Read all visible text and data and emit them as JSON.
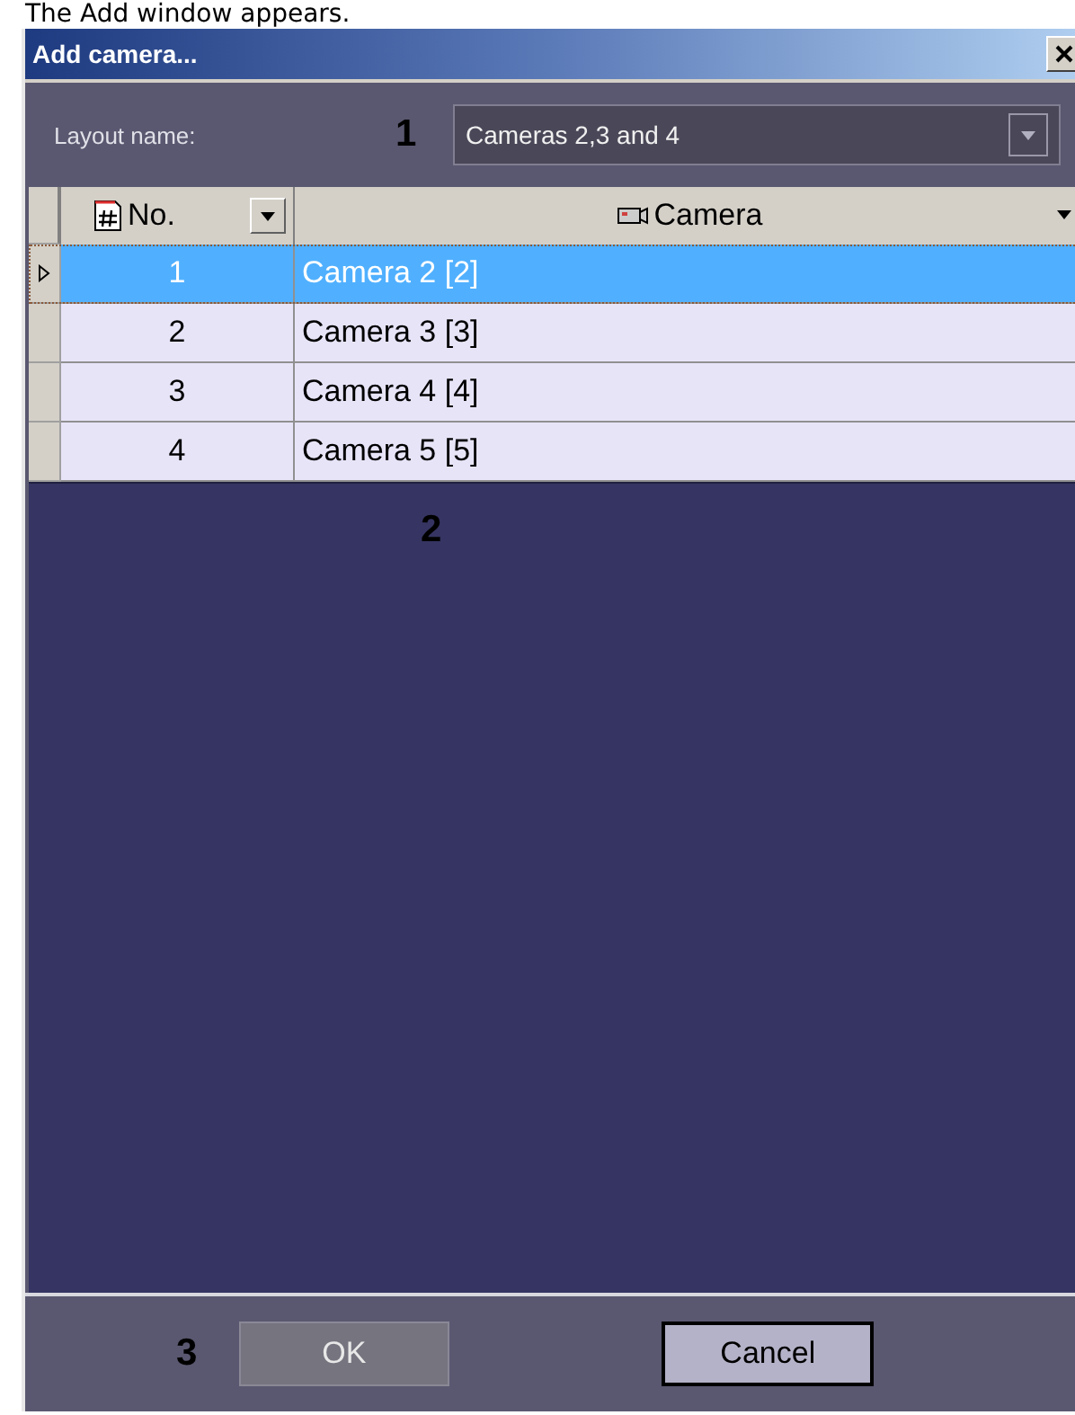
{
  "caption": "The Add window appears.",
  "window": {
    "title": "Add camera..."
  },
  "layout": {
    "label": "Layout name:",
    "callout": "1",
    "value": "Cameras 2,3 and 4"
  },
  "table": {
    "columns": [
      {
        "label": "No.",
        "kind": "number"
      },
      {
        "label": "Camera",
        "kind": "device"
      }
    ],
    "rows": [
      {
        "selected": true,
        "cells": [
          "1",
          "Camera 2 [2]"
        ]
      },
      {
        "selected": false,
        "cells": [
          "2",
          "Camera 3 [3]"
        ]
      },
      {
        "selected": false,
        "cells": [
          "3",
          "Camera 4 [4]"
        ]
      },
      {
        "selected": false,
        "cells": [
          "4",
          "Camera 5 [5]"
        ]
      }
    ],
    "callout": "2"
  },
  "footer": {
    "callout": "3",
    "buttons": [
      {
        "label": "OK",
        "disabled": true
      },
      {
        "label": "Cancel",
        "disabled": false
      }
    ]
  }
}
